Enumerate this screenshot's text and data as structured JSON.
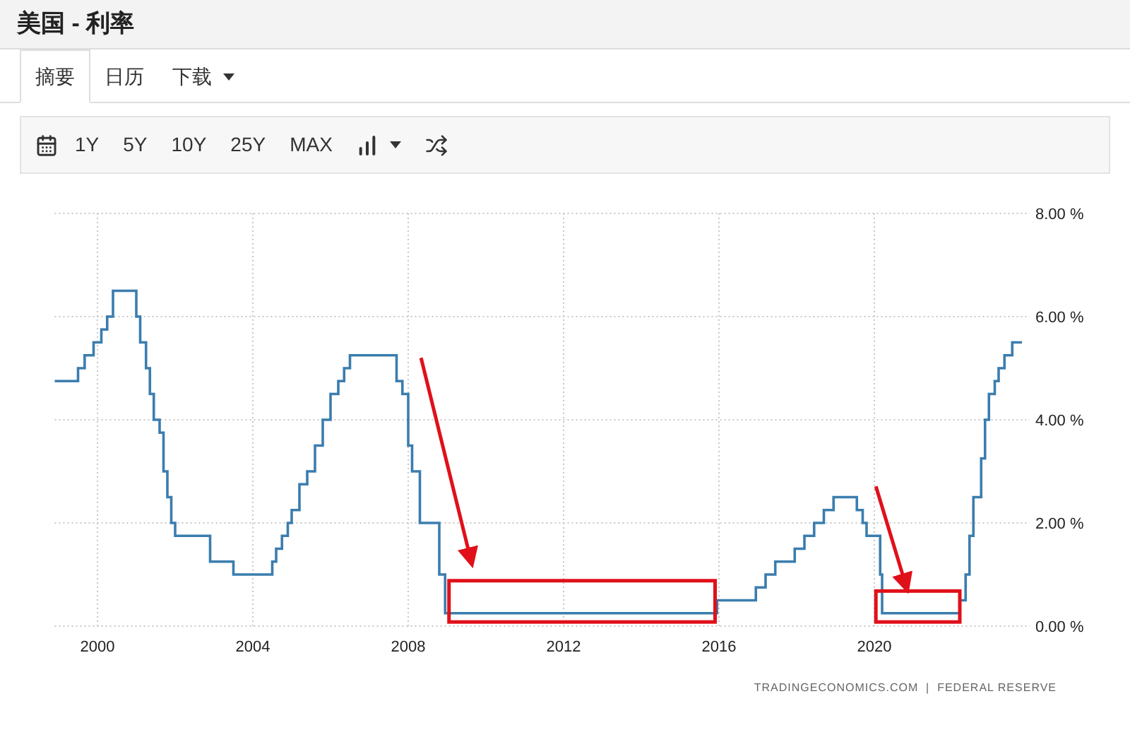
{
  "title": "美国 - 利率",
  "tabs": [
    {
      "label": "摘要",
      "selected": true,
      "dropdown": false
    },
    {
      "label": "日历",
      "selected": false,
      "dropdown": false
    },
    {
      "label": "下载",
      "selected": false,
      "dropdown": true
    }
  ],
  "toolbar": {
    "ranges": [
      "1Y",
      "5Y",
      "10Y",
      "25Y",
      "MAX"
    ]
  },
  "chart": {
    "chart_data": {
      "type": "line",
      "grid": true,
      "x": [
        1998.9,
        1999.5,
        1999.5,
        1999.67,
        1999.67,
        1999.9,
        1999.9,
        2000.1,
        2000.1,
        2000.25,
        2000.25,
        2000.4,
        2000.4,
        2001.0,
        2001.0,
        2001.1,
        2001.1,
        2001.25,
        2001.25,
        2001.35,
        2001.35,
        2001.45,
        2001.45,
        2001.6,
        2001.6,
        2001.7,
        2001.7,
        2001.8,
        2001.8,
        2001.9,
        2001.9,
        2002.0,
        2002.0,
        2002.9,
        2002.9,
        2003.5,
        2003.5,
        2004.5,
        2004.5,
        2004.6,
        2004.6,
        2004.75,
        2004.75,
        2004.9,
        2004.9,
        2005.0,
        2005.0,
        2005.2,
        2005.2,
        2005.4,
        2005.4,
        2005.6,
        2005.6,
        2005.8,
        2005.8,
        2006.0,
        2006.0,
        2006.2,
        2006.2,
        2006.35,
        2006.35,
        2006.5,
        2006.5,
        2007.7,
        2007.7,
        2007.85,
        2007.85,
        2008.0,
        2008.0,
        2008.1,
        2008.1,
        2008.3,
        2008.3,
        2008.8,
        2008.8,
        2008.95,
        2008.95,
        2015.95,
        2015.95,
        2016.95,
        2016.95,
        2017.2,
        2017.2,
        2017.45,
        2017.45,
        2017.95,
        2017.95,
        2018.2,
        2018.2,
        2018.45,
        2018.45,
        2018.7,
        2018.7,
        2018.95,
        2018.95,
        2019.55,
        2019.55,
        2019.7,
        2019.7,
        2019.8,
        2019.8,
        2020.15,
        2020.15,
        2020.2,
        2020.2,
        2022.2,
        2022.2,
        2022.35,
        2022.35,
        2022.45,
        2022.45,
        2022.55,
        2022.55,
        2022.75,
        2022.75,
        2022.85,
        2022.85,
        2022.95,
        2022.95,
        2023.1,
        2023.1,
        2023.2,
        2023.2,
        2023.35,
        2023.35,
        2023.55,
        2023.55,
        2023.8
      ],
      "series": [
        {
          "color": "#3b7dae",
          "values": [
            4.75,
            4.75,
            5.0,
            5.0,
            5.25,
            5.25,
            5.5,
            5.5,
            5.75,
            5.75,
            6.0,
            6.0,
            6.5,
            6.5,
            6.0,
            6.0,
            5.5,
            5.5,
            5.0,
            5.0,
            4.5,
            4.5,
            4.0,
            4.0,
            3.75,
            3.75,
            3.0,
            3.0,
            2.5,
            2.5,
            2.0,
            2.0,
            1.75,
            1.75,
            1.25,
            1.25,
            1.0,
            1.0,
            1.25,
            1.25,
            1.5,
            1.5,
            1.75,
            1.75,
            2.0,
            2.0,
            2.25,
            2.25,
            2.75,
            2.75,
            3.0,
            3.0,
            3.5,
            3.5,
            4.0,
            4.0,
            4.5,
            4.5,
            4.75,
            4.75,
            5.0,
            5.0,
            5.25,
            5.25,
            4.75,
            4.75,
            4.5,
            4.5,
            3.5,
            3.5,
            3.0,
            3.0,
            2.0,
            2.0,
            1.0,
            1.0,
            0.25,
            0.25,
            0.5,
            0.5,
            0.75,
            0.75,
            1.0,
            1.0,
            1.25,
            1.25,
            1.5,
            1.5,
            1.75,
            1.75,
            2.0,
            2.0,
            2.25,
            2.25,
            2.5,
            2.5,
            2.25,
            2.25,
            2.0,
            2.0,
            1.75,
            1.75,
            1.0,
            1.0,
            0.25,
            0.25,
            0.5,
            0.5,
            1.0,
            1.0,
            1.75,
            1.75,
            2.5,
            2.5,
            3.25,
            3.25,
            4.0,
            4.0,
            4.5,
            4.5,
            4.75,
            4.75,
            5.0,
            5.0,
            5.25,
            5.25,
            5.5,
            5.5
          ]
        }
      ],
      "xlim": [
        1998.9,
        2024
      ],
      "ylim": [
        0,
        8
      ],
      "xticks": [
        {
          "value": 2000,
          "label": "2000"
        },
        {
          "value": 2004,
          "label": "2004"
        },
        {
          "value": 2008,
          "label": "2008"
        },
        {
          "value": 2012,
          "label": "2012"
        },
        {
          "value": 2016,
          "label": "2016"
        },
        {
          "value": 2020,
          "label": "2020"
        }
      ],
      "yticks": [
        {
          "value": 0,
          "label": "0.00 %"
        },
        {
          "value": 2,
          "label": "2.00 %"
        },
        {
          "value": 4,
          "label": "4.00 %"
        },
        {
          "value": 6,
          "label": "6.00 %"
        },
        {
          "value": 8,
          "label": "8.00 %"
        }
      ]
    },
    "markup": [
      {
        "kind": "box"
      },
      {
        "kind": "box"
      },
      {
        "kind": "arrow"
      },
      {
        "kind": "arrow"
      }
    ],
    "source": "TRADINGECONOMICS.COM  |  FEDERAL RESERVE"
  }
}
